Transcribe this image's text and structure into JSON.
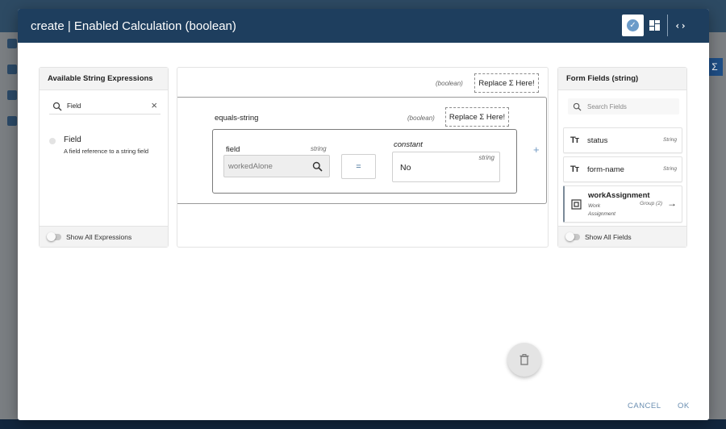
{
  "modal": {
    "title": "create | Enabled Calculation (boolean)",
    "header_icons": [
      "check-circle-icon",
      "dashboard-icon",
      "code-icon"
    ]
  },
  "left_panel": {
    "title": "Available String Expressions",
    "search_value": "Field",
    "expressions": [
      {
        "name": "Field",
        "description": "A field reference to a string field"
      }
    ],
    "footer_toggle": "Show All Expressions"
  },
  "canvas": {
    "outer": {
      "type_note": "(boolean)",
      "replace_label": "Replace Σ Here!"
    },
    "equals_block": {
      "label": "equals-string",
      "type_note": "(boolean)",
      "replace_label": "Replace Σ Here!",
      "field": {
        "label": "field",
        "type": "string",
        "value": "workedAlone"
      },
      "operator": "=",
      "constant": {
        "label": "constant",
        "type": "string",
        "value": "No"
      }
    },
    "add_symbol": "+"
  },
  "right_panel": {
    "title": "Form Fields (string)",
    "search_placeholder": "Search Fields",
    "fields": [
      {
        "icon": "Tт",
        "name": "status",
        "type": "String"
      },
      {
        "icon": "Tт",
        "name": "form-name",
        "type": "String"
      },
      {
        "name": "workAssignment",
        "subtitle": "Work Assignment",
        "type": "Group (2)"
      }
    ],
    "footer_toggle": "Show All Fields"
  },
  "footer": {
    "cancel": "CANCEL",
    "ok": "OK"
  }
}
